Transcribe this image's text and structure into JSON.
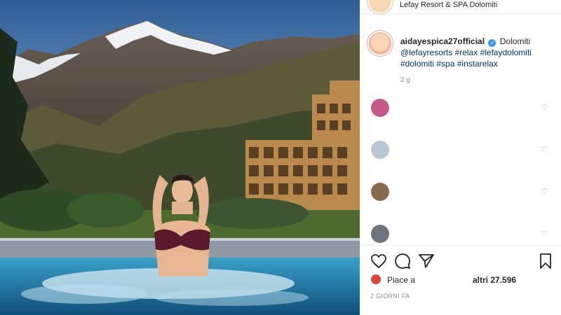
{
  "post": {
    "location": "Lefay Resort & SPA Dolomiti",
    "time_ago": "2 GIORNI FA"
  },
  "caption": {
    "username": "aidayespica27official",
    "verified_icon": "✓",
    "location_word": "Dolomiti",
    "tags": [
      "@lefayresorts",
      "#relax",
      "#lefaydolomiti",
      "#dolomiti",
      "#spa",
      "#instarelax"
    ],
    "time": "2 g"
  },
  "comments": [
    {
      "avatar_color": "#c45a8c",
      "heart": "♡"
    },
    {
      "avatar_color": "#b9c7d4",
      "heart": "♡"
    },
    {
      "avatar_color": "#8a6a4c",
      "heart": "♡"
    },
    {
      "avatar_color": "#6d747c",
      "heart": "♡"
    }
  ],
  "actions": {
    "icons": [
      "heart-icon",
      "comment-icon",
      "share-icon",
      "bookmark-icon"
    ]
  },
  "likes": {
    "prefix": "Piace a",
    "suffix": "altri 27.596"
  },
  "colors": {
    "accent_link": "#00376b",
    "verified": "#3897f0",
    "muted": "#8e8e8e"
  }
}
